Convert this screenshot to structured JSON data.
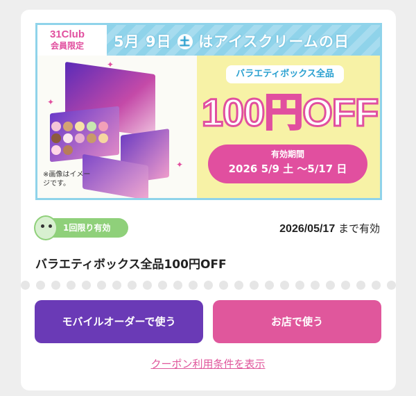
{
  "banner": {
    "club_logo": "31Club",
    "members_only": "会員限定",
    "title_month": "5",
    "title_month_unit": "月",
    "title_day": "9",
    "title_day_unit": "日",
    "title_weekday": "土",
    "title_rest": "はアイスクリームの日",
    "variety_label": "バラエティボックス全品",
    "discount": "100円OFF",
    "period_label": "有効期間",
    "period_dates": "2026 5/9 土 〜5/17 日",
    "image_note": "※画像はイメージです。"
  },
  "coupon": {
    "usage_badge": "1回限り有効",
    "expiry_date": "2026/05/17",
    "expiry_suffix": " まで有効",
    "title": "バラエティボックス全品100円OFF"
  },
  "actions": {
    "mobile_order": "モバイルオーダーで使う",
    "in_store": "お店で使う",
    "terms_link": "クーポン利用条件を表示"
  },
  "colors": {
    "accent_pink": "#e0579c",
    "accent_purple": "#6a3ab6",
    "badge_green": "#8fd07a",
    "banner_blue": "#8fd3ea",
    "banner_yellow": "#f7f2a6"
  }
}
